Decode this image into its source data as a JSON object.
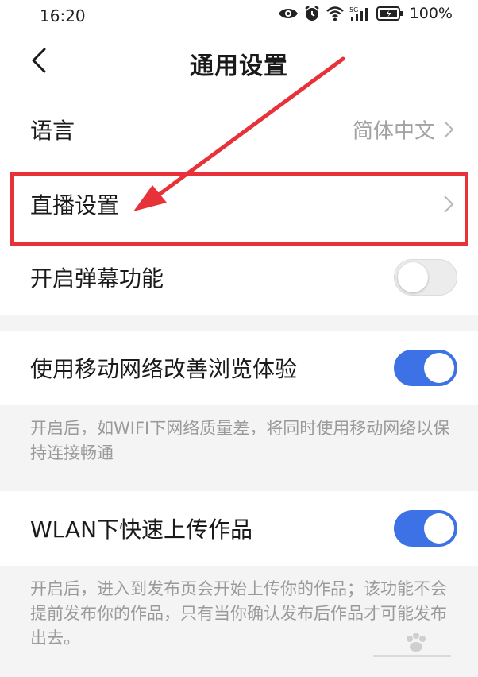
{
  "status_bar": {
    "time": "16:20",
    "battery_text": "100%",
    "icons": [
      "eye-icon",
      "alarm-icon",
      "wifi-icon",
      "5g-signal-icon",
      "battery-icon"
    ]
  },
  "header": {
    "title": "通用设置",
    "back_icon": "back-arrow-icon"
  },
  "settings": {
    "language": {
      "label": "语言",
      "value": "简体中文"
    },
    "live": {
      "label": "直播设置"
    },
    "danmaku": {
      "label": "开启弹幕功能",
      "enabled": false
    },
    "mobile_network": {
      "label": "使用移动网络改善浏览体验",
      "enabled": true,
      "description": "开启后，如WIFI下网络质量差，将同时使用移动网络以保持连接畅通"
    },
    "wlan_upload": {
      "label": "WLAN下快速上传作品",
      "enabled": true,
      "description": "开启后，进入到发布页会开始上传你的作品；该功能不会提前发布你的作品，只有当你确认发布后作品才可能发布出去。"
    }
  },
  "annotation": {
    "highlight_color": "#e8323a"
  },
  "colors": {
    "toggle_on": "#3d72e6",
    "toggle_off": "#ececec",
    "background": "#f4f4f4"
  }
}
